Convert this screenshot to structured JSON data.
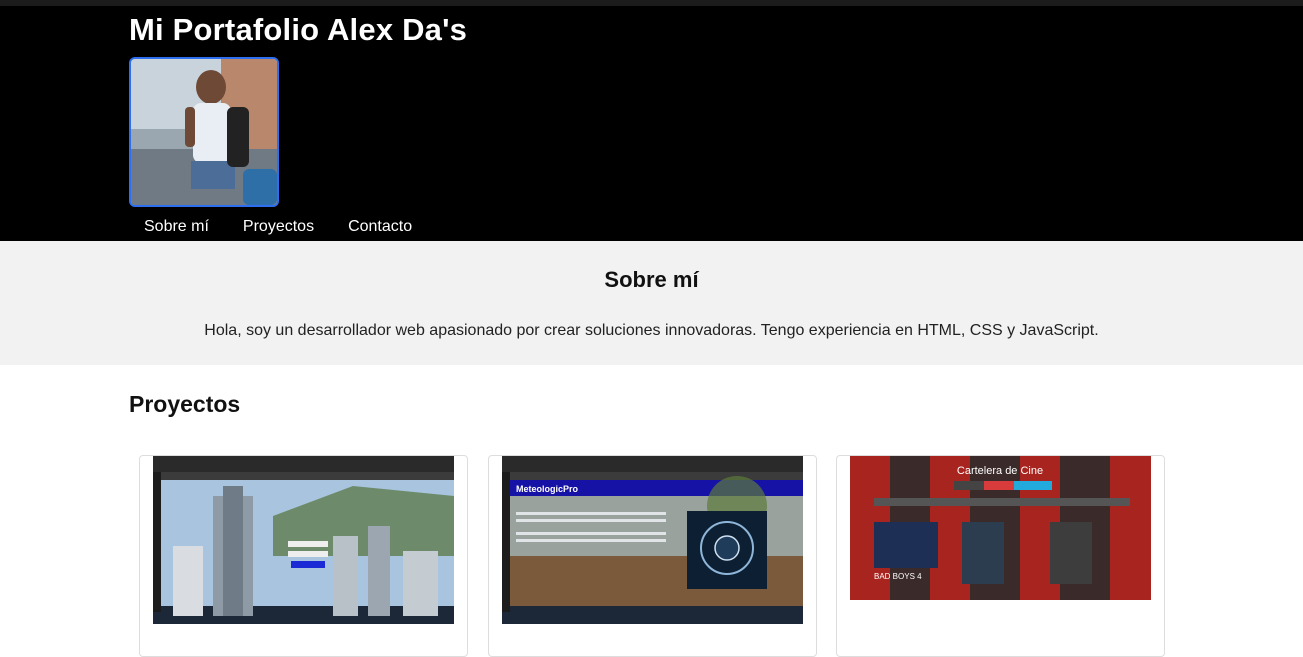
{
  "header": {
    "title": "Mi Portafolio Alex Da's",
    "profile_alt": "profile-photo"
  },
  "nav": {
    "items": [
      "Sobre mí",
      "Proyectos",
      "Contacto"
    ]
  },
  "about": {
    "heading": "Sobre mí",
    "text": "Hola, soy un desarrollador web apasionado por crear soluciones innovadoras. Tengo experiencia en HTML, CSS y JavaScript."
  },
  "projects": {
    "heading": "Proyectos",
    "cards": [
      {
        "thumb": "login-city-screenshot",
        "title": ""
      },
      {
        "thumb": "meteologicpro-screenshot",
        "thumb_brand": "MeteologicPro",
        "title": ""
      },
      {
        "thumb": "cartelera-cine-screenshot",
        "thumb_heading": "Cartelera de Cine",
        "thumb_movie": "BAD BOYS 4",
        "title": ""
      }
    ]
  },
  "colors": {
    "header_bg": "#000000",
    "about_bg": "#f2f2f2",
    "profile_border": "#2d6ff0"
  }
}
